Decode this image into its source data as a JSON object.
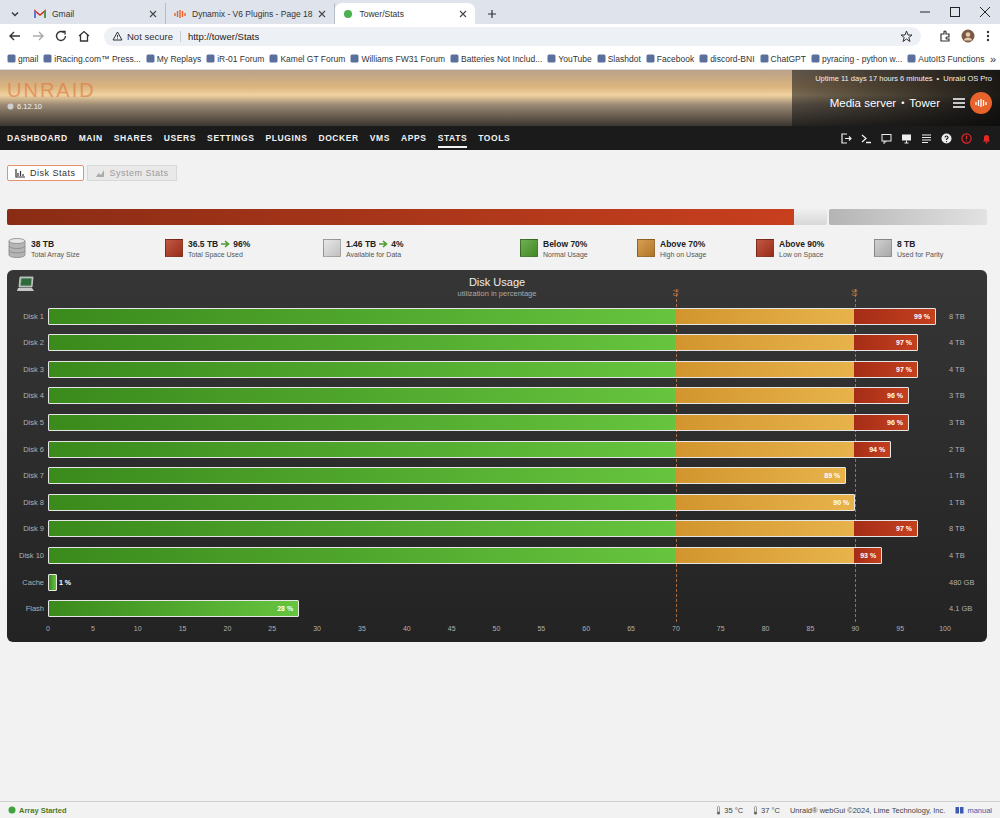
{
  "browser": {
    "tabs": [
      {
        "title": "Gmail",
        "kind": "gmail",
        "selected": false
      },
      {
        "title": "Dynamix - V6 Plugins - Page 18",
        "kind": "unraid",
        "selected": false
      },
      {
        "title": "Tower/Stats",
        "kind": "site",
        "selected": true
      }
    ],
    "address": {
      "security": "Not secure",
      "url": "http://tower/Stats"
    },
    "bookmarks": [
      "gmail",
      "iRacing.com™ Press...",
      "My Replays",
      "iR-01 Forum",
      "Kamel GT Forum",
      "Williams FW31 Forum",
      "Batteries Not Includ...",
      "YouTube",
      "Slashdot",
      "Facebook",
      "discord-BNI",
      "ChatGPT",
      "pyracing - python w...",
      "AutoIt3 Functions"
    ],
    "bookmarks_overflow": "»"
  },
  "header": {
    "logo": "UNRAID",
    "version": "6.12.10",
    "uptime": "Uptime 11 days 17 hours 6 minutes",
    "separator": "•",
    "license": "Unraid OS Pro",
    "description": "Media server",
    "server_name": "Tower"
  },
  "nav": [
    {
      "label": "DASHBOARD",
      "selected": false
    },
    {
      "label": "MAIN",
      "selected": false
    },
    {
      "label": "SHARES",
      "selected": false
    },
    {
      "label": "USERS",
      "selected": false
    },
    {
      "label": "SETTINGS",
      "selected": false
    },
    {
      "label": "PLUGINS",
      "selected": false
    },
    {
      "label": "DOCKER",
      "selected": false
    },
    {
      "label": "VMS",
      "selected": false
    },
    {
      "label": "APPS",
      "selected": false
    },
    {
      "label": "STATS",
      "selected": true
    },
    {
      "label": "TOOLS",
      "selected": false
    }
  ],
  "page_tabs": [
    {
      "label": "Disk Stats",
      "selected": true
    },
    {
      "label": "System Stats",
      "selected": false
    }
  ],
  "usage_bar": {
    "used_level": 0.96,
    "parity_level": 1
  },
  "legend": [
    {
      "kind": "disk",
      "value": "38 TB",
      "label": "Total Array Size",
      "color": "#b5b5b5"
    },
    {
      "kind": "swatch",
      "value": "36.5 TB",
      "percent": "96%",
      "label": "Total Space Used",
      "color": "#b3341c"
    },
    {
      "kind": "swatch",
      "value": "1.46 TB",
      "percent": "4%",
      "label": "Available for Data",
      "color": "#e2e2e2"
    },
    {
      "kind": "swatch",
      "value": "Below 70%",
      "label": "Normal Usage",
      "color": "#4e9f2c"
    },
    {
      "kind": "swatch",
      "value": "Above 70%",
      "label": "High on Usage",
      "color": "#cf8a2e"
    },
    {
      "kind": "swatch",
      "value": "Above 90%",
      "label": "Low on Space",
      "color": "#b3341c"
    },
    {
      "kind": "swatch",
      "value": "8 TB",
      "label": "Used for Parity",
      "color": "#c6c6c6"
    }
  ],
  "chart": {
    "title": "Disk Usage",
    "subtitle": "utilization in percentage",
    "max": 100,
    "thresholds": [
      {
        "label": "70",
        "value": 70
      },
      {
        "label": "90",
        "value": 90
      }
    ],
    "axis_ticks": [
      "0",
      "5",
      "10",
      "15",
      "20",
      "25",
      "30",
      "35",
      "40",
      "45",
      "50",
      "55",
      "60",
      "65",
      "70",
      "75",
      "80",
      "85",
      "90",
      "95",
      "100"
    ],
    "bars": [
      {
        "name": "Disk 1",
        "value": 99,
        "reading": "99 %",
        "size": "8 TB"
      },
      {
        "name": "Disk 2",
        "value": 97,
        "reading": "97 %",
        "size": "4 TB"
      },
      {
        "name": "Disk 3",
        "value": 97,
        "reading": "97 %",
        "size": "4 TB"
      },
      {
        "name": "Disk 4",
        "value": 96,
        "reading": "96 %",
        "size": "3 TB"
      },
      {
        "name": "Disk 5",
        "value": 96,
        "reading": "96 %",
        "size": "3 TB"
      },
      {
        "name": "Disk 6",
        "value": 94,
        "reading": "94 %",
        "size": "2 TB"
      },
      {
        "name": "Disk 7",
        "value": 89,
        "reading": "89 %",
        "size": "1 TB"
      },
      {
        "name": "Disk 8",
        "value": 90,
        "reading": "90 %",
        "size": "1 TB"
      },
      {
        "name": "Disk 9",
        "value": 97,
        "reading": "97 %",
        "size": "8 TB"
      },
      {
        "name": "Disk 10",
        "value": 93,
        "reading": "93 %",
        "size": "4 TB"
      },
      {
        "name": "Cache",
        "value": 1,
        "reading": "1 %",
        "size": "480 GB"
      },
      {
        "name": "Flash",
        "value": 28,
        "reading": "28 %",
        "size": "4.1 GB"
      }
    ]
  },
  "status_bar": {
    "array_status": "Array Started",
    "array_ok": true,
    "temperatures": [
      "35 °C",
      "37 °C"
    ],
    "copyright": "Unraid® webGui ©2024, Lime Technology, Inc.",
    "manual": "manual"
  }
}
